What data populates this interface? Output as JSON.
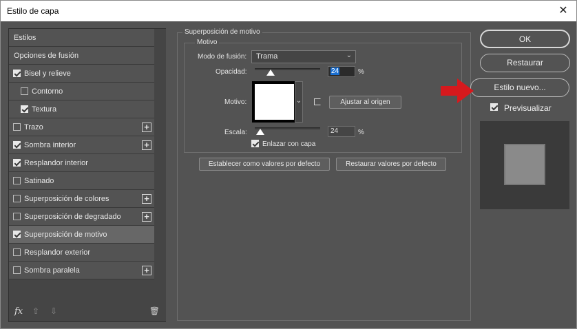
{
  "window": {
    "title": "Estilo de capa",
    "close_glyph": "✕"
  },
  "styles_list": {
    "header": "Estilos",
    "items": [
      {
        "label": "Opciones de fusión",
        "checkbox": false,
        "checked": false,
        "indent": false,
        "plus": false
      },
      {
        "label": "Bisel y relieve",
        "checkbox": true,
        "checked": true,
        "indent": false,
        "plus": false
      },
      {
        "label": "Contorno",
        "checkbox": true,
        "checked": false,
        "indent": true,
        "plus": false
      },
      {
        "label": "Textura",
        "checkbox": true,
        "checked": true,
        "indent": true,
        "plus": false
      },
      {
        "label": "Trazo",
        "checkbox": true,
        "checked": false,
        "indent": false,
        "plus": true
      },
      {
        "label": "Sombra interior",
        "checkbox": true,
        "checked": true,
        "indent": false,
        "plus": true
      },
      {
        "label": "Resplandor interior",
        "checkbox": true,
        "checked": true,
        "indent": false,
        "plus": false
      },
      {
        "label": "Satinado",
        "checkbox": true,
        "checked": false,
        "indent": false,
        "plus": false
      },
      {
        "label": "Superposición de colores",
        "checkbox": true,
        "checked": false,
        "indent": false,
        "plus": true
      },
      {
        "label": "Superposición de degradado",
        "checkbox": true,
        "checked": false,
        "indent": false,
        "plus": true
      },
      {
        "label": "Superposición de motivo",
        "checkbox": true,
        "checked": true,
        "indent": false,
        "plus": false,
        "selected": true
      },
      {
        "label": "Resplandor exterior",
        "checkbox": true,
        "checked": false,
        "indent": false,
        "plus": false
      },
      {
        "label": "Sombra paralela",
        "checkbox": true,
        "checked": false,
        "indent": false,
        "plus": true
      }
    ],
    "plus_glyph": "+",
    "bottom": {
      "fx": "fx",
      "up_glyph": "⇧",
      "down_glyph": "⇩",
      "trash_glyph": "🗑"
    }
  },
  "pattern_overlay": {
    "section_title": "Superposición de motivo",
    "group_title": "Motivo",
    "blend_mode_label": "Modo de fusión:",
    "blend_mode_value": "Trama",
    "opacity_label": "Opacidad:",
    "opacity_value": "24",
    "opacity_unit": "%",
    "opacity_level": 0.24,
    "pattern_label": "Motivo:",
    "snap_button": "Ajustar al origen",
    "scale_label": "Escala:",
    "scale_value": "24",
    "scale_unit": "%",
    "scale_level": 0.08,
    "link_label": "Enlazar con capa",
    "link_checked": true,
    "default_button": "Establecer como valores por defecto",
    "reset_button": "Restaurar valores por defecto"
  },
  "actions": {
    "ok": "OK",
    "restore": "Restaurar",
    "new_style": "Estilo nuevo...",
    "preview_label": "Previsualizar",
    "preview_checked": true
  },
  "colors": {
    "background": "#535353",
    "panel": "#454545",
    "selected_row": "#676767",
    "arrow": "#d6191d",
    "highlight": "#1a6fd1"
  }
}
